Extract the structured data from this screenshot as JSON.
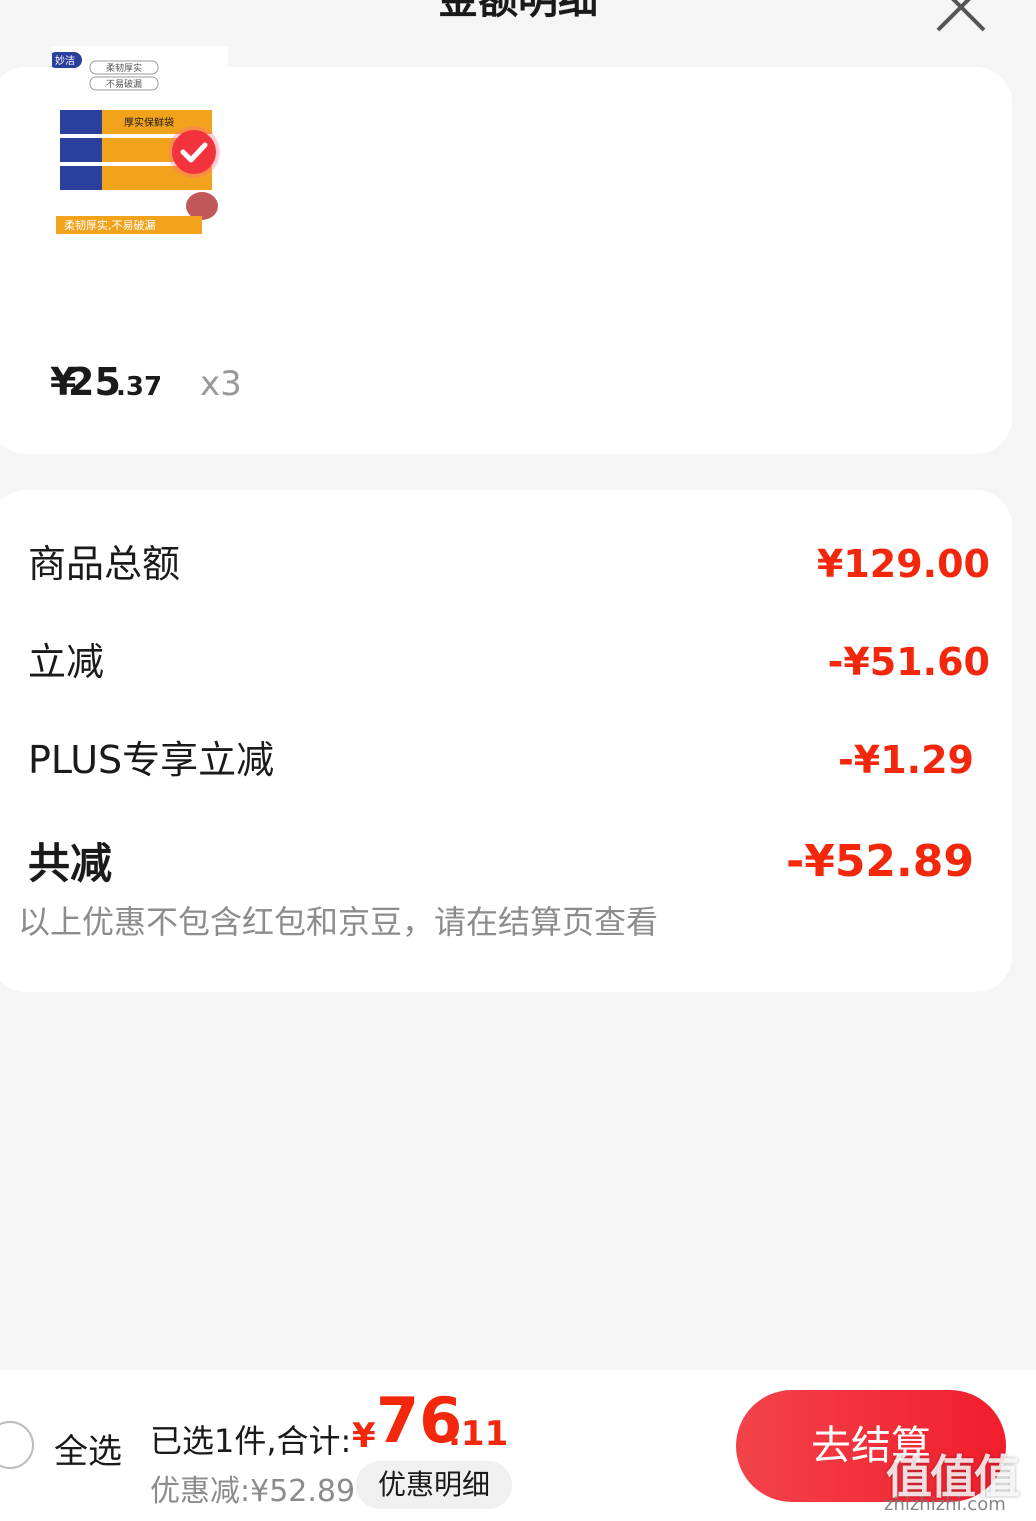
{
  "header": {
    "title": "金额明细"
  },
  "product": {
    "price_symbol": "¥",
    "price_int": "25",
    "price_dec": ".37",
    "quantity": "x3",
    "checked": true,
    "image": {
      "brand": "妙洁",
      "tag1": "柔韧厚实",
      "tag2": "不易破漏",
      "roll_label": "厚实保鲜袋",
      "banner": "柔韧厚实,不易破漏"
    }
  },
  "summary": {
    "rows": [
      {
        "label": "商品总额",
        "value": "¥129.00"
      },
      {
        "label": "立减",
        "value": "-¥51.60"
      },
      {
        "label": "PLUS专享立减",
        "value": "-¥1.29"
      }
    ],
    "total_label": "共减",
    "total_value": "-¥52.89",
    "note": "以上优惠不包含红包和京豆，请在结算页查看"
  },
  "footer": {
    "select_all": "全选",
    "selected_text": "已选1件,合计:",
    "sum_symbol": "¥",
    "sum_int": "76",
    "sum_dec": ".11",
    "discount_text": "优惠减:¥52.89",
    "detail_button": "优惠明细",
    "checkout_button": "去结算"
  },
  "watermark": {
    "text": "值值值",
    "url": "zhizhizhi.com"
  },
  "colors": {
    "accent": "#f2270c",
    "background": "#f5f5f5",
    "card": "#ffffff"
  }
}
